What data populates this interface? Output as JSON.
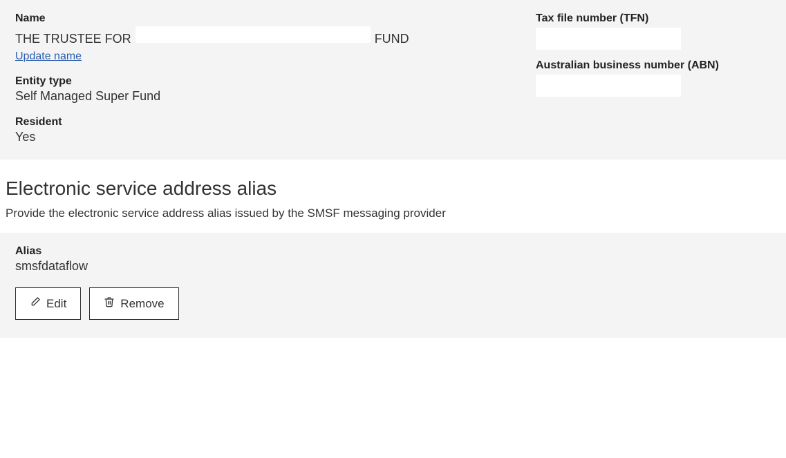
{
  "details": {
    "name_label": "Name",
    "name_prefix": "THE TRUSTEE FOR",
    "name_suffix": "FUND",
    "update_name_link": "Update name",
    "entity_type_label": "Entity type",
    "entity_type_value": "Self Managed Super Fund",
    "resident_label": "Resident",
    "resident_value": "Yes",
    "tfn_label": "Tax file number (TFN)",
    "abn_label": "Australian business number (ABN)"
  },
  "esa": {
    "heading": "Electronic service address alias",
    "description": "Provide the electronic service address alias issued by the SMSF messaging provider",
    "alias_label": "Alias",
    "alias_value": "smsfdataflow",
    "edit_label": "Edit",
    "remove_label": "Remove"
  }
}
